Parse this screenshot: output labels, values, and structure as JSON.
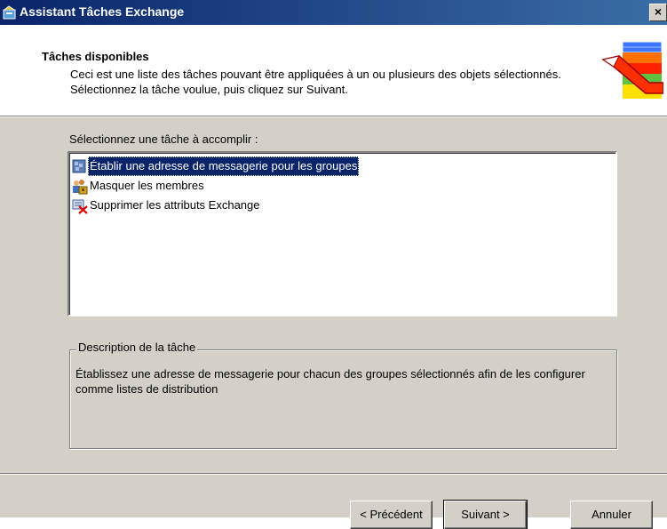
{
  "window": {
    "title": "Assistant Tâches Exchange",
    "close_label": "×"
  },
  "header": {
    "title": "Tâches disponibles",
    "description": "Ceci est une liste des tâches pouvant être appliquées à un ou plusieurs des objets sélectionnés. Sélectionnez la tâche voulue, puis cliquez sur Suivant."
  },
  "task_list": {
    "label": "Sélectionnez une tâche à accomplir :",
    "items": [
      {
        "label": "Établir une adresse de messagerie pour les groupes",
        "icon": "mail-group-icon",
        "selected": true
      },
      {
        "label": "Masquer les membres",
        "icon": "users-lock-icon",
        "selected": false
      },
      {
        "label": "Supprimer les attributs Exchange",
        "icon": "delete-attributes-icon",
        "selected": false
      }
    ]
  },
  "task_description": {
    "legend": "Description de la tâche",
    "text": "Établissez une adresse de messagerie pour chacun des groupes sélectionnés afin de les configurer comme listes de distribution"
  },
  "buttons": {
    "back": "< Précédent",
    "next": "Suivant >",
    "cancel": "Annuler"
  },
  "colors": {
    "title_bar": "#0a246a",
    "dialog_face": "#d4d0c8",
    "selection": "#0a246a"
  }
}
